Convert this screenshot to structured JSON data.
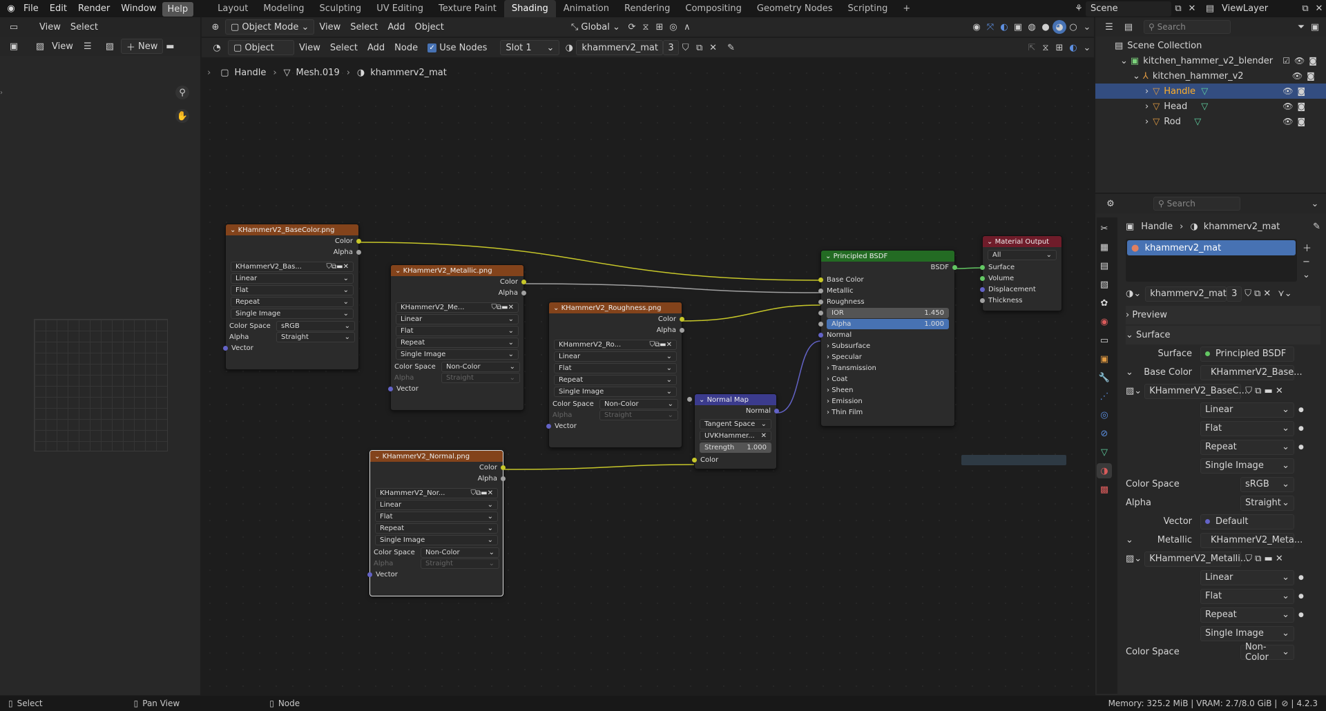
{
  "topbar": {
    "menus": [
      "File",
      "Edit",
      "Render",
      "Window",
      "Help"
    ],
    "workspaces": [
      "Layout",
      "Modeling",
      "Sculpting",
      "UV Editing",
      "Texture Paint",
      "Shading",
      "Animation",
      "Rendering",
      "Compositing",
      "Geometry Nodes",
      "Scripting"
    ],
    "active_workspace": "Shading",
    "add_tab": "+",
    "scene": "Scene",
    "view_layer": "ViewLayer"
  },
  "image_editor": {
    "menus": [
      "View",
      "Select"
    ],
    "view_label": "View",
    "new_label": "New"
  },
  "node_header": {
    "editor_type": "Object",
    "menus": [
      "View",
      "Select",
      "Add",
      "Node"
    ],
    "use_nodes_label": "Use Nodes",
    "slot": "Slot 1",
    "material": "khammerv2_mat",
    "users": "3"
  },
  "viewport_header": {
    "mode": "Object Mode",
    "menus": [
      "View",
      "Select",
      "Add",
      "Object"
    ],
    "orientation": "Global"
  },
  "breadcrumb": [
    "Handle",
    "Mesh.019",
    "khammerv2_mat"
  ],
  "nodes": {
    "basecolor": {
      "title": "KHammerV2_BaseColor.png",
      "outputs": [
        "Color",
        "Alpha"
      ],
      "image": "KHammerV2_Bas...",
      "interp": "Linear",
      "proj": "Flat",
      "ext": "Repeat",
      "source": "Single Image",
      "cs_label": "Color Space",
      "cs": "sRGB",
      "alpha_label": "Alpha",
      "alpha": "Straight",
      "vector": "Vector"
    },
    "metallic": {
      "title": "KHammerV2_Metallic.png",
      "outputs": [
        "Color",
        "Alpha"
      ],
      "image": "KHammerV2_Me...",
      "interp": "Linear",
      "proj": "Flat",
      "ext": "Repeat",
      "source": "Single Image",
      "cs_label": "Color Space",
      "cs": "Non-Color",
      "alpha_label": "Alpha",
      "alpha": "Straight",
      "vector": "Vector"
    },
    "roughness": {
      "title": "KHammerV2_Roughness.png",
      "outputs": [
        "Color",
        "Alpha"
      ],
      "image": "KHammerV2_Ro...",
      "interp": "Linear",
      "proj": "Flat",
      "ext": "Repeat",
      "source": "Single Image",
      "cs_label": "Color Space",
      "cs": "Non-Color",
      "alpha_label": "Alpha",
      "alpha": "Straight",
      "vector": "Vector"
    },
    "normal": {
      "title": "KHammerV2_Normal.png",
      "outputs": [
        "Color",
        "Alpha"
      ],
      "image": "KHammerV2_Nor...",
      "interp": "Linear",
      "proj": "Flat",
      "ext": "Repeat",
      "source": "Single Image",
      "cs_label": "Color Space",
      "cs": "Non-Color",
      "alpha_label": "Alpha",
      "alpha": "Straight",
      "vector": "Vector"
    },
    "normalmap": {
      "title": "Normal Map",
      "output": "Normal",
      "space": "Tangent Space",
      "uv": "UVKHammer...",
      "strength_label": "Strength",
      "strength": "1.000",
      "color": "Color"
    },
    "bsdf": {
      "title": "Principled BSDF",
      "output": "BSDF",
      "inputs": [
        "Base Color",
        "Metallic",
        "Roughness"
      ],
      "ior_label": "IOR",
      "ior": "1.450",
      "alpha_label": "Alpha",
      "alpha": "1.000",
      "normal": "Normal",
      "panels": [
        "Subsurface",
        "Specular",
        "Transmission",
        "Coat",
        "Sheen",
        "Emission",
        "Thin Film"
      ]
    },
    "output": {
      "title": "Material Output",
      "target": "All",
      "inputs": [
        "Surface",
        "Volume",
        "Displacement",
        "Thickness"
      ]
    }
  },
  "outliner": {
    "search_placeholder": "Search",
    "collection": "Scene Collection",
    "items": [
      {
        "name": "kitchen_hammer_v2_blender",
        "level": 1
      },
      {
        "name": "kitchen_hammer_v2",
        "level": 2
      },
      {
        "name": "Handle",
        "level": 3,
        "selected": true
      },
      {
        "name": "Head",
        "level": 3
      },
      {
        "name": "Rod",
        "level": 3
      }
    ]
  },
  "properties": {
    "search_placeholder": "Search",
    "crumb_object": "Handle",
    "crumb_material": "khammerv2_mat",
    "slot_name": "khammerv2_mat",
    "material": "khammerv2_mat",
    "users": "3",
    "preview": "Preview",
    "surface_panel": "Surface",
    "surface_label": "Surface",
    "surface_value": "Principled BSDF",
    "base_color_label": "Base Color",
    "base_color_value": "KHammerV2_Base...",
    "base_image": "KHammerV2_BaseC...",
    "interp": "Linear",
    "proj": "Flat",
    "ext": "Repeat",
    "source": "Single Image",
    "cs_label": "Color Space",
    "cs": "sRGB",
    "alpha_label": "Alpha",
    "alpha": "Straight",
    "vector_label": "Vector",
    "vector": "Default",
    "metallic_label": "Metallic",
    "metallic_value": "KHammerV2_Meta...",
    "metallic_image": "KHammerV2_Metalli...",
    "m_interp": "Linear",
    "m_proj": "Flat",
    "m_ext": "Repeat",
    "m_source": "Single Image",
    "m_cs_label": "Color Space",
    "m_cs": "Non-Color"
  },
  "statusbar": {
    "select": "Select",
    "pan": "Pan View",
    "node": "Node",
    "memory": "Memory: 325.2 MiB | VRAM: 2.7/8.0 GiB |",
    "version": "4.2.3"
  },
  "colors": {
    "texture_header": "#83431b",
    "bsdf_header": "#236b23",
    "output_header": "#6f1c2a",
    "vector_header": "#3b3b8d",
    "accent": "#4772b3"
  }
}
